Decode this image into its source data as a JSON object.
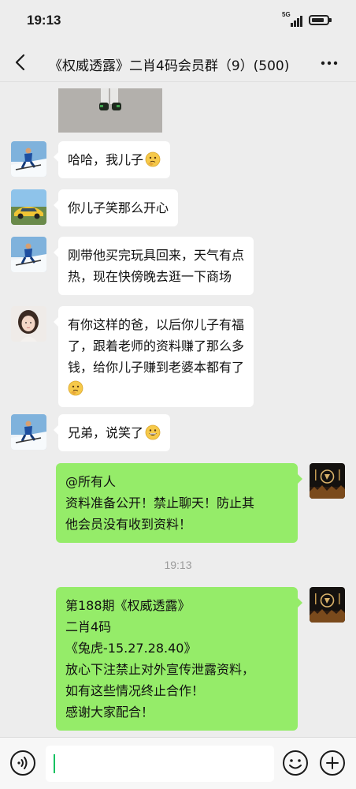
{
  "status_bar": {
    "time": "19:13",
    "network": "5G"
  },
  "header": {
    "title": "《权威透露》二肖4码会员群（9）(500)"
  },
  "messages": [
    {
      "sender": "avatar-skier",
      "side": "left",
      "lines": [
        "哈哈，我儿子"
      ],
      "emoji": "thinking-face"
    },
    {
      "sender": "avatar-car",
      "side": "left",
      "lines": [
        "你儿子笑那么开心"
      ]
    },
    {
      "sender": "avatar-skier",
      "side": "left",
      "lines": [
        "刚带他买完玩具回来，天气有点",
        "热，现在快傍晚去逛一下商场"
      ]
    },
    {
      "sender": "avatar-woman",
      "side": "left",
      "lines": [
        "有你这样的爸，以后你儿子有福",
        "了，跟着老师的资料赚了那么多",
        "钱，给你儿子赚到老婆本都有了"
      ],
      "emoji": "thinking-face"
    },
    {
      "sender": "avatar-skier",
      "side": "left",
      "lines": [
        "兄弟，说笑了"
      ],
      "emoji": "grinning-face"
    },
    {
      "sender": "avatar-dark-logo",
      "side": "right",
      "lines": [
        "@所有人",
        "资料准备公开！禁止聊天！防止其",
        "他会员没有收到资料！"
      ]
    },
    {
      "sender": "avatar-dark-logo",
      "side": "right",
      "lines": [
        "第188期《权威透露》",
        "二肖4码",
        "《兔虎-15.27.28.40》",
        "放心下注禁止对外宣传泄露资料，",
        "如有这些情况终止合作！",
        "感谢大家配合！"
      ]
    }
  ],
  "time_divider": "19:13",
  "input": {
    "value": ""
  },
  "colors": {
    "background": "#ededed",
    "bubble_left": "#ffffff",
    "bubble_right": "#95ec69",
    "caret": "#07c160"
  }
}
